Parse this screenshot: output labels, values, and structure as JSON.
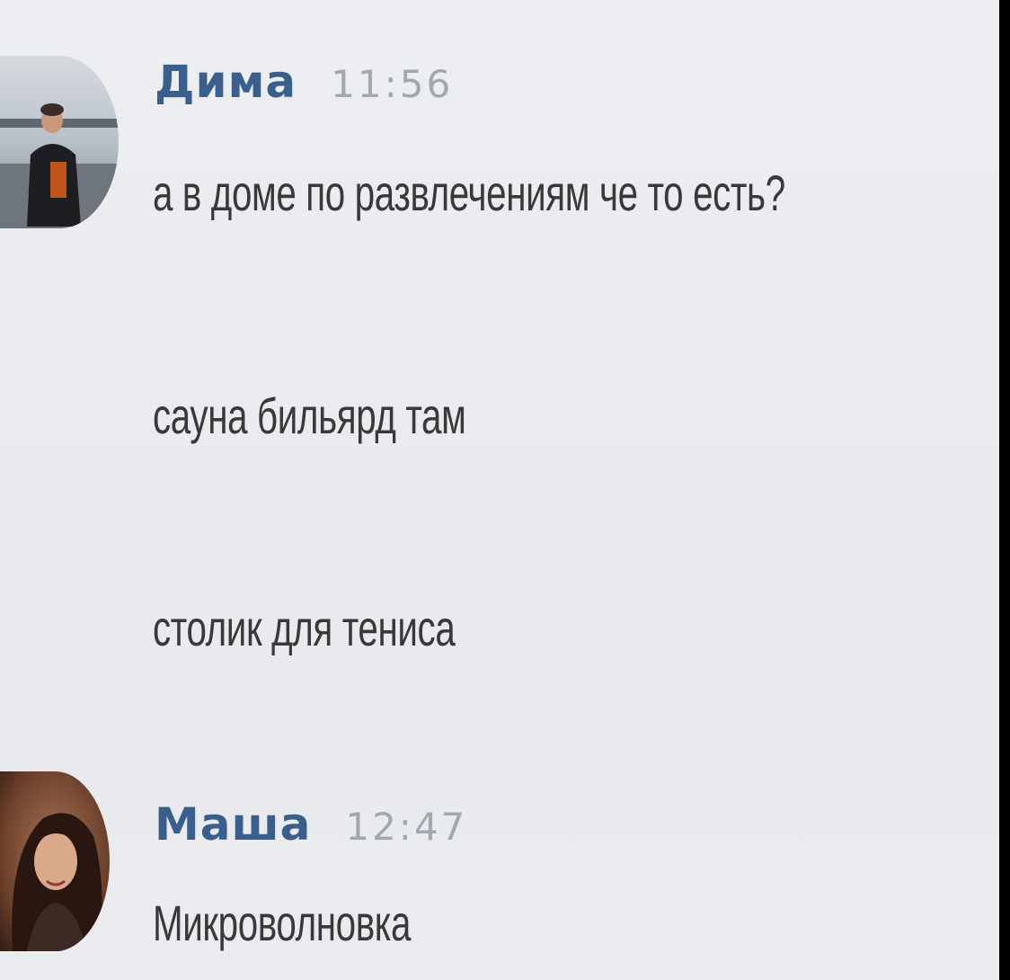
{
  "messages": [
    {
      "author": "Дима",
      "time": "11:56",
      "lines": [
        "а в доме по развлечениям че то есть?",
        "сауна бильярд там",
        "столик для тениса"
      ]
    },
    {
      "author": "Маша",
      "time": "12:47",
      "lines": [
        "Микроволновка"
      ]
    }
  ]
}
